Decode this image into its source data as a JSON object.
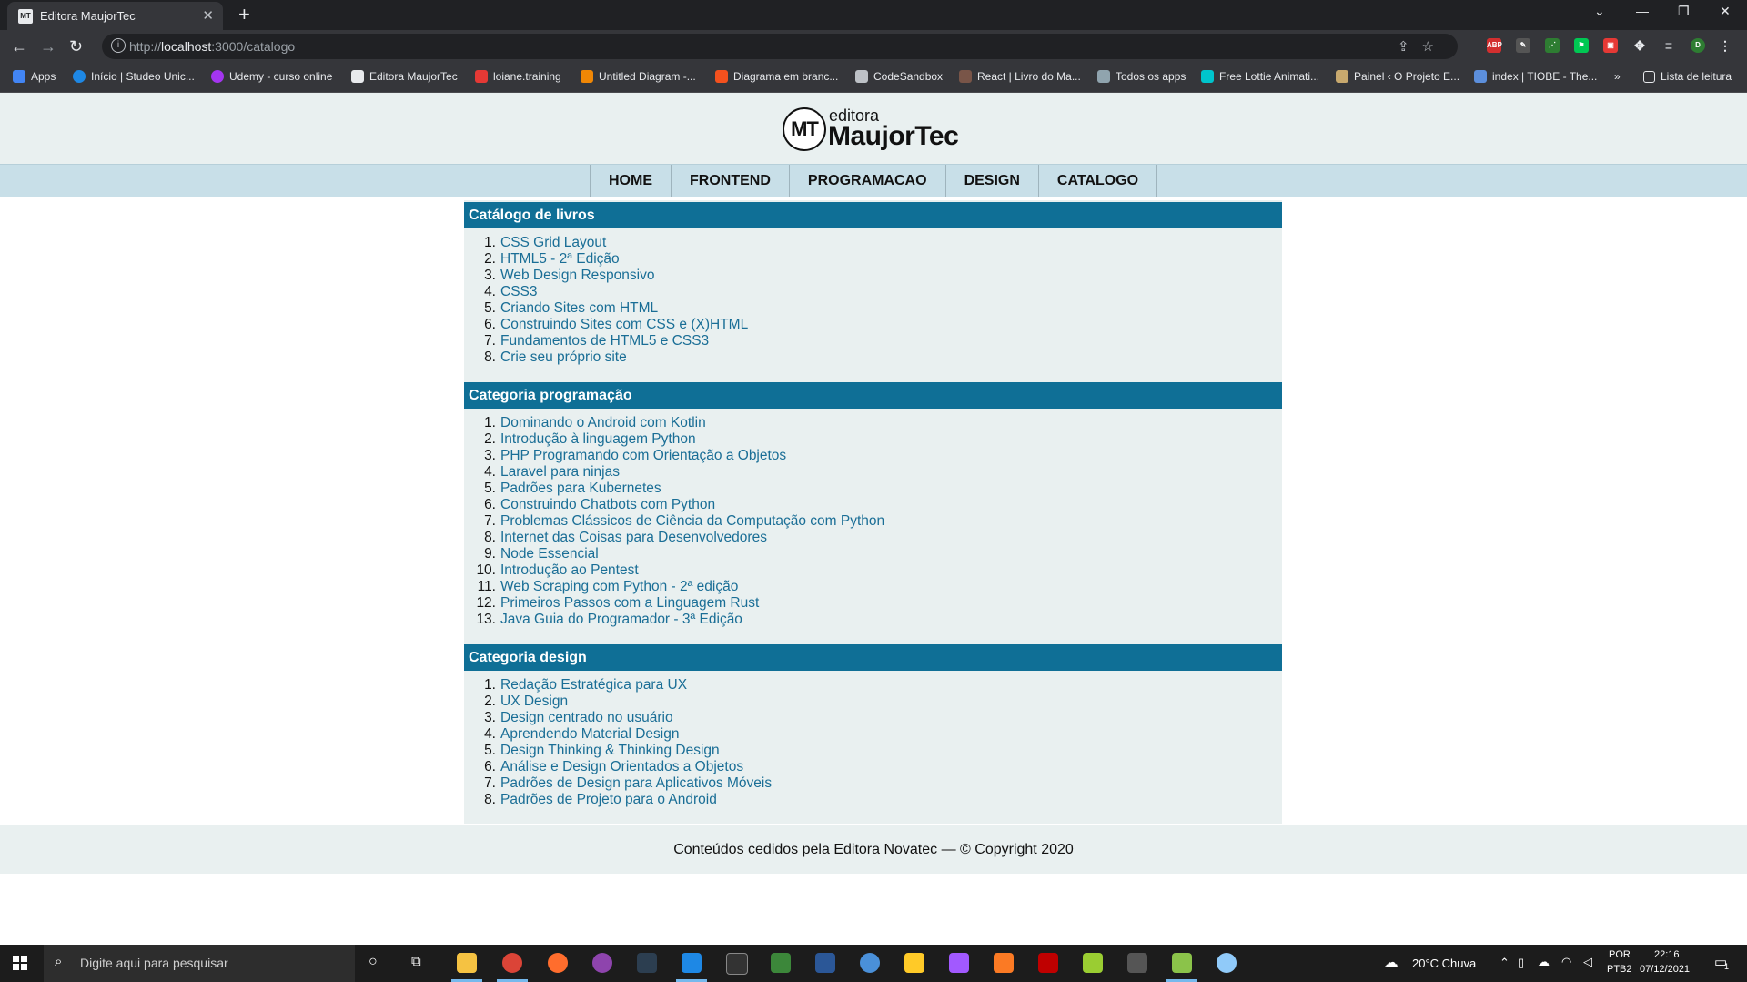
{
  "browser": {
    "tab_title": "Editora MaujorTec",
    "tab_favicon": "MT",
    "url_prefix": "http://",
    "url_host": "localhost",
    "url_path": ":3000/catalogo",
    "bookmarks": [
      {
        "label": "Apps",
        "color": "#4285f4"
      },
      {
        "label": "Início | Studeo Unic...",
        "color": "#1e88e5"
      },
      {
        "label": "Udemy - curso online",
        "color": "#a435f0"
      },
      {
        "label": "Editora MaujorTec",
        "color": "#e8eaed"
      },
      {
        "label": "loiane.training",
        "color": "#e53935"
      },
      {
        "label": "Untitled Diagram -...",
        "color": "#f08705"
      },
      {
        "label": "Diagrama em branc...",
        "color": "#f4511e"
      },
      {
        "label": "CodeSandbox",
        "color": "#bdc1c6"
      },
      {
        "label": "React | Livro do Ma...",
        "color": "#795548"
      },
      {
        "label": "Todos os apps",
        "color": "#90a4ae"
      },
      {
        "label": "Free Lottie Animati...",
        "color": "#00c4cc"
      },
      {
        "label": "Painel ‹ O Projeto E...",
        "color": "#c8a96e"
      },
      {
        "label": "index | TIOBE - The...",
        "color": "#5c8fdc"
      }
    ],
    "bookmarks_more": "»",
    "reading_list": "Lista de leitura"
  },
  "site": {
    "logo_mark": "MT",
    "logo_small": "editora",
    "logo_big": "MaujorTec",
    "nav": [
      "HOME",
      "FRONTEND",
      "PROGRAMACAO",
      "DESIGN",
      "CATALOGO"
    ],
    "sections": [
      {
        "title": "Catálogo de livros",
        "books": [
          "CSS Grid Layout",
          "HTML5 - 2ª Edição",
          "Web Design Responsivo",
          "CSS3",
          "Criando Sites com HTML",
          "Construindo Sites com CSS e (X)HTML",
          "Fundamentos de HTML5 e CSS3",
          "Crie seu próprio site"
        ]
      },
      {
        "title": "Categoria programação",
        "books": [
          "Dominando o Android com Kotlin",
          "Introdução à linguagem Python",
          "PHP Programando com Orientação a Objetos",
          "Laravel para ninjas",
          "Padrões para Kubernetes",
          "Construindo Chatbots com Python",
          "Problemas Clássicos de Ciência da Computação com Python",
          "Internet das Coisas para Desenvolvedores",
          "Node Essencial",
          "Introdução ao Pentest",
          "Web Scraping com Python - 2ª edição",
          "Primeiros Passos com a Linguagem Rust",
          "Java Guia do Programador - 3ª Edição"
        ]
      },
      {
        "title": "Categoria design",
        "books": [
          "Redação Estratégica para UX",
          "UX Design",
          "Design centrado no usuário",
          "Aprendendo Material Design",
          "Design Thinking & Thinking Design",
          "Análise e Design Orientados a Objetos",
          "Padrões de Design para Aplicativos Móveis",
          "Padrões de Projeto para o Android"
        ]
      }
    ],
    "footer": "Conteúdos cedidos pela Editora Novatec — © Copyright 2020"
  },
  "taskbar": {
    "search_placeholder": "Digite aqui para pesquisar",
    "weather": "20°C  Chuva",
    "language": "POR",
    "keyboard": "PTB2",
    "time": "22:16",
    "date": "07/12/2021",
    "notifications": "1"
  }
}
